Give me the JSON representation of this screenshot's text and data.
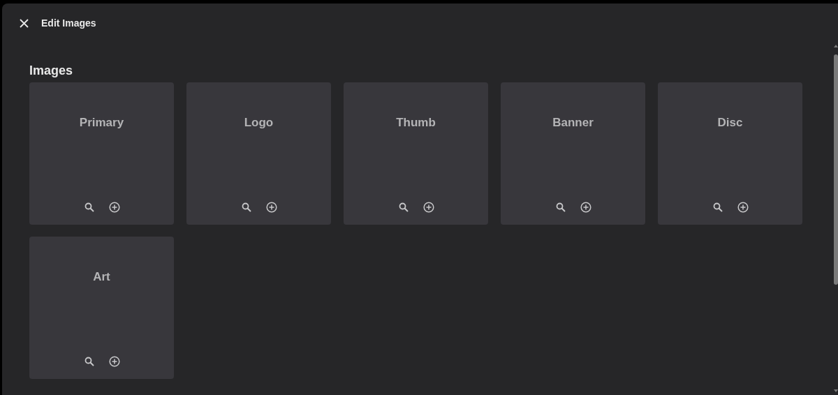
{
  "dialog": {
    "title": "Edit Images"
  },
  "section": {
    "heading": "Images"
  },
  "images": [
    {
      "label": "Primary"
    },
    {
      "label": "Logo"
    },
    {
      "label": "Thumb"
    },
    {
      "label": "Banner"
    },
    {
      "label": "Disc"
    },
    {
      "label": "Art"
    }
  ]
}
